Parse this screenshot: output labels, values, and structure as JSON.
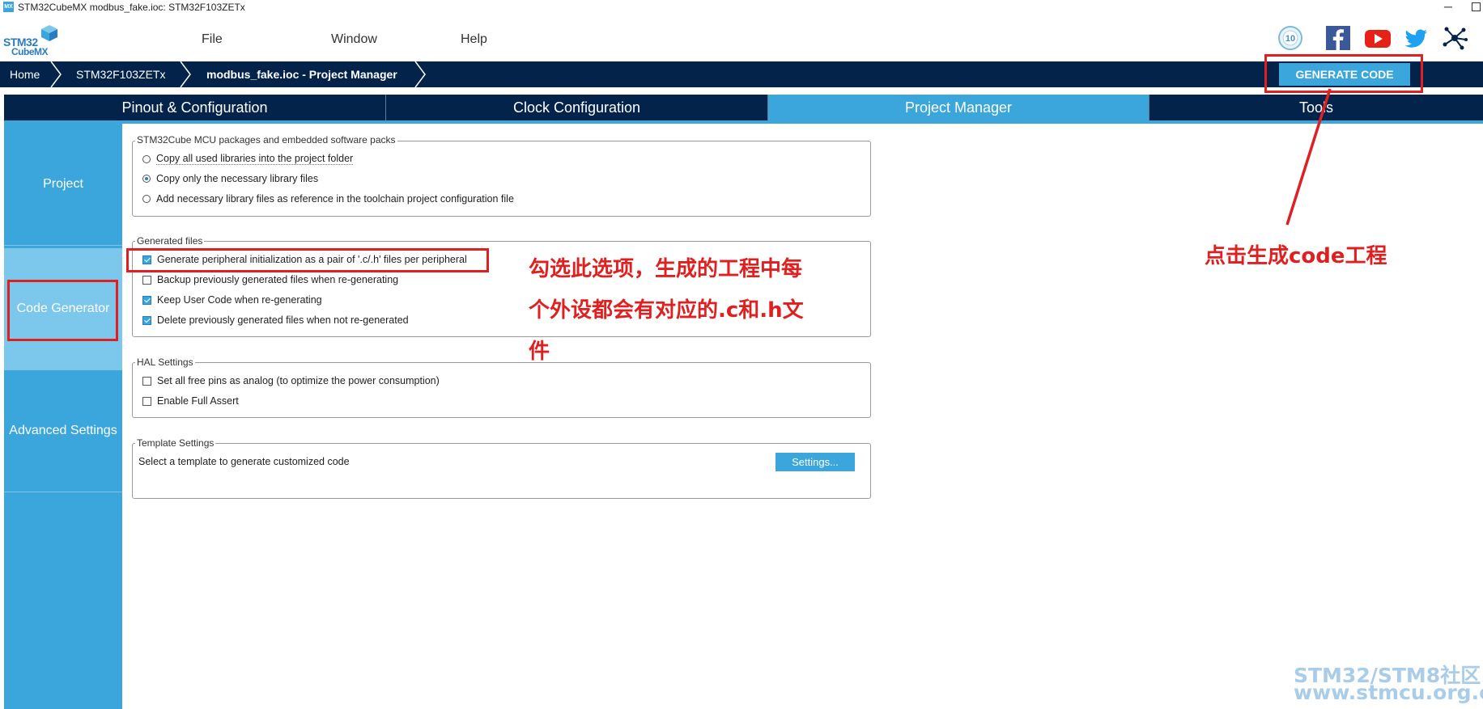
{
  "window": {
    "title": "STM32CubeMX modbus_fake.ioc: STM32F103ZETx",
    "app_icon": "MX",
    "minimize": "─"
  },
  "logo": {
    "line1": "STM32",
    "line2": "CubeMX"
  },
  "menu": [
    "File",
    "Window",
    "Help"
  ],
  "social_icons": [
    "anniversary-10-icon",
    "facebook-icon",
    "youtube-icon",
    "twitter-icon",
    "network-share-icon"
  ],
  "badge_10": "10",
  "breadcrumb": [
    "Home",
    "STM32F103ZETx",
    "modbus_fake.ioc - Project Manager"
  ],
  "generate_button": "GENERATE CODE",
  "tabs": [
    "Pinout & Configuration",
    "Clock Configuration",
    "Project Manager",
    "Tools"
  ],
  "active_tab": "Project Manager",
  "sidebar": [
    "Project",
    "Code Generator",
    "Advanced Settings"
  ],
  "active_sidebar": "Code Generator",
  "packages": {
    "legend": "STM32Cube MCU packages and embedded software packs",
    "options": [
      {
        "label": "Copy all used libraries into the project folder",
        "selected": false
      },
      {
        "label": "Copy only the necessary library files",
        "selected": true
      },
      {
        "label": "Add necessary library files as reference in the toolchain project configuration file",
        "selected": false
      }
    ]
  },
  "generated_files": {
    "legend": "Generated files",
    "options": [
      {
        "label": "Generate peripheral initialization as a pair of '.c/.h' files per peripheral",
        "checked": true
      },
      {
        "label": "Backup previously generated files when re-generating",
        "checked": false
      },
      {
        "label": "Keep User Code when re-generating",
        "checked": true
      },
      {
        "label": "Delete previously generated files when not re-generated",
        "checked": true
      }
    ]
  },
  "hal_settings": {
    "legend": "HAL Settings",
    "options": [
      {
        "label": "Set all free pins as analog (to optimize the power consumption)",
        "checked": false
      },
      {
        "label": "Enable Full Assert",
        "checked": false
      }
    ]
  },
  "template_settings": {
    "legend": "Template Settings",
    "text": "Select a template to generate customized code",
    "button": "Settings..."
  },
  "annotations": {
    "checkbox_note": [
      "勾选此选项，生成的工程中每",
      "个外设都会有对应的.c和.h文",
      "件"
    ],
    "generate_note": "点击生成code工程"
  },
  "watermark": {
    "line1": "STM32/STM8社区",
    "line2": "www.stmcu.org.cn"
  },
  "colors": {
    "navy": "#03234b",
    "accent": "#3aa6dc",
    "sidebar_active": "#7cc8ec",
    "annotation": "#e02020"
  }
}
